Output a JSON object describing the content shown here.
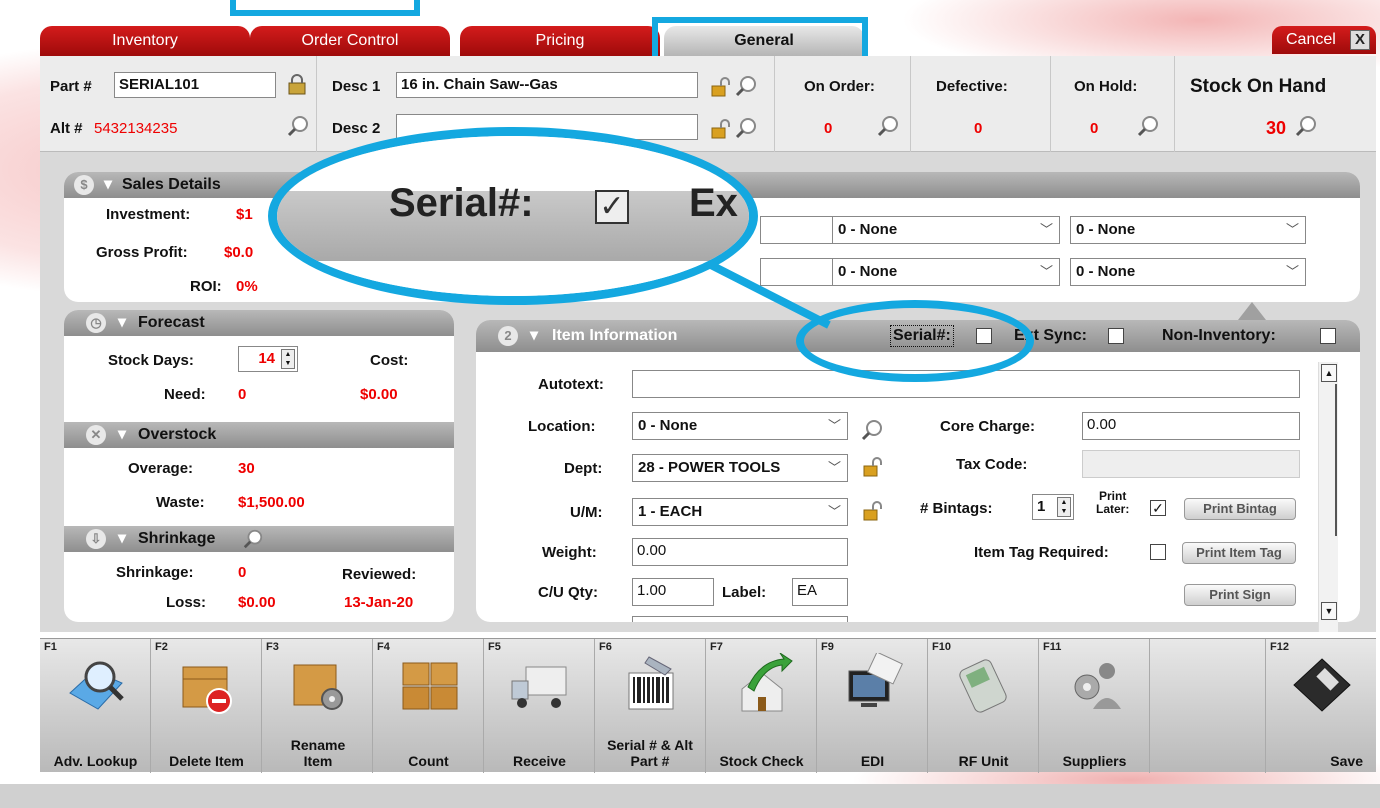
{
  "tabs": [
    {
      "label": "Inventory"
    },
    {
      "label": "Order Control"
    },
    {
      "label": "Pricing"
    },
    {
      "label": "General"
    }
  ],
  "cancel": {
    "label": "Cancel",
    "close": "X"
  },
  "header": {
    "part_label": "Part #",
    "part_value": "SERIAL101",
    "alt_label": "Alt #",
    "alt_value": "5432134235",
    "desc1_label": "Desc 1",
    "desc1_value": "16 in. Chain Saw--Gas",
    "desc2_label": "Desc 2",
    "desc2_value": "",
    "on_order_label": "On Order:",
    "on_order_value": "0",
    "defective_label": "Defective:",
    "defective_value": "0",
    "on_hold_label": "On Hold:",
    "on_hold_value": "0",
    "soh_label": "Stock On Hand",
    "soh_value": "30"
  },
  "sales": {
    "title": "Sales Details",
    "investment_label": "Investment:",
    "investment_value": "$1",
    "gross_label": "Gross Profit:",
    "gross_value": "$0.0",
    "roi_label": "ROI:",
    "roi_value": "0%",
    "selects": [
      "0 - None",
      "0 - None",
      "0 - None",
      "0 - None"
    ]
  },
  "forecast": {
    "title": "Forecast",
    "stock_days_label": "Stock Days:",
    "stock_days_value": "14",
    "cost_label": "Cost:",
    "cost_value": "$0.00",
    "need_label": "Need:",
    "need_value": "0"
  },
  "overstock": {
    "title": "Overstock",
    "overage_label": "Overage:",
    "overage_value": "30",
    "waste_label": "Waste:",
    "waste_value": "$1,500.00"
  },
  "shrinkage": {
    "title": "Shrinkage",
    "shrinkage_label": "Shrinkage:",
    "shrinkage_value": "0",
    "reviewed_label": "Reviewed:",
    "loss_label": "Loss:",
    "loss_value": "$0.00",
    "reviewed_value": "13-Jan-20"
  },
  "item_info": {
    "number": "2",
    "title": "Item Information",
    "serial_label": "Serial#:",
    "serial_checked": true,
    "ext_sync_label": "Ext Sync:",
    "non_inventory_label": "Non-Inventory:",
    "autotext_label": "Autotext:",
    "autotext_value": "",
    "location_label": "Location:",
    "location_value": "0 - None",
    "dept_label": "Dept:",
    "dept_value": "28 - POWER TOOLS",
    "um_label": "U/M:",
    "um_value": "1 - EACH",
    "weight_label": "Weight:",
    "weight_value": "0.00",
    "cuqty_label": "C/U Qty:",
    "cuqty_value": "1.00",
    "label_label": "Label:",
    "label_value": "EA",
    "core_label": "Core Charge:",
    "core_value": "0.00",
    "tax_label": "Tax Code:",
    "tax_value": "",
    "bintags_label": "# Bintags:",
    "bintags_value": "1",
    "print_later_label_1": "Print",
    "print_later_label_2": "Later:",
    "print_bintag": "Print Bintag",
    "item_tag_label": "Item Tag Required:",
    "print_item_tag": "Print Item Tag",
    "print_sign": "Print Sign"
  },
  "zoom": {
    "serial_label": "Serial#:",
    "ext_fragment": "Ex"
  },
  "toolbar": [
    {
      "key": "F1",
      "label": "Adv. Lookup",
      "icon": "magnifier-icon"
    },
    {
      "key": "F2",
      "label": "Delete Item",
      "icon": "box-delete-icon"
    },
    {
      "key": "F3",
      "label": "Rename Item",
      "icon": "box-gears-icon"
    },
    {
      "key": "F4",
      "label": "Count",
      "icon": "boxes-icon"
    },
    {
      "key": "F5",
      "label": "Receive",
      "icon": "truck-icon"
    },
    {
      "key": "F6",
      "label": "Serial # & Alt Part #",
      "icon": "barcode-icon"
    },
    {
      "key": "F7",
      "label": "Stock Check",
      "icon": "house-arrow-icon"
    },
    {
      "key": "F9",
      "label": "EDI",
      "icon": "computer-icon"
    },
    {
      "key": "F10",
      "label": "RF Unit",
      "icon": "handheld-icon"
    },
    {
      "key": "F11",
      "label": "Suppliers",
      "icon": "suppliers-icon"
    },
    {
      "key": "",
      "label": "",
      "icon": ""
    },
    {
      "key": "F12",
      "label": "Save",
      "icon": "floppy-disk-icon"
    }
  ]
}
